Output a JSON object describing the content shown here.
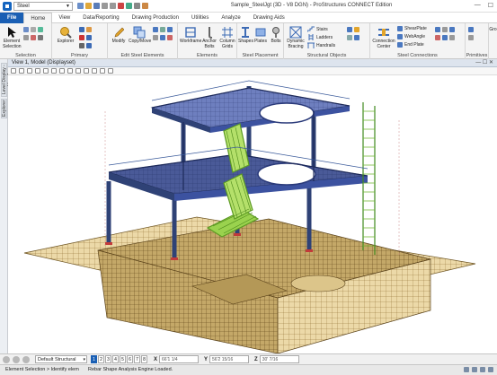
{
  "window": {
    "title": "Sample_SteelJgt (3D - V8 DGN) - ProStructures CONNECT Edition",
    "workspace": "Steel"
  },
  "ribbon_tabs": [
    "File",
    "Home",
    "View",
    "Data/Reporting",
    "Drawing Production",
    "Utilities",
    "Analyze",
    "Drawing Aids"
  ],
  "ribbon": {
    "selection": {
      "label": "Selection",
      "element_selection": "Element Selection"
    },
    "primary": {
      "label": "Primary",
      "explorer": "Explorer"
    },
    "edit_steel": {
      "label": "Edit Steel Elements",
      "modify": "Modify",
      "copy_move": "Copy/Move"
    },
    "elements": {
      "label": "Elements",
      "workframe": "Workframe",
      "anchor_bolts": "Anchor Bolts",
      "column_grids": "Column Grids"
    },
    "steel_placement": {
      "label": "Steel Placement",
      "shapes": "Shapes",
      "plates": "Plates",
      "bolts": "Bolts"
    },
    "structural_objects": {
      "label": "Structural Objects",
      "dynamic_bracing": "Dynamic Bracing",
      "stairs": "Stairs",
      "ladders": "Ladders",
      "handrails": "Handrails"
    },
    "steel_connections": {
      "label": "Steel Connections",
      "connection_center": "Connection Center",
      "shear_plate": "ShearPlate",
      "web_angle": "WebAngle",
      "end_plate": "End Plate"
    },
    "primitives": {
      "label": "Primitives"
    },
    "extra": {
      "label": "Gro"
    }
  },
  "view": {
    "title": "View 1, Model (Displayset)",
    "side_tabs": [
      "Level Display - View 1",
      "Explorer"
    ]
  },
  "bottom": {
    "model": "Default Structural mod",
    "view_numbers": [
      "1",
      "2",
      "3",
      "4",
      "5",
      "6",
      "7",
      "8"
    ],
    "x_label": "X",
    "x_value": "66'1 1/4",
    "y_label": "Y",
    "y_value": "56'2 15/16",
    "z_label": "Z",
    "z_value": "30' 7/16"
  },
  "status": {
    "prompt": "Element Selection > Identify elem",
    "message": "Rebar Shape Analysis Engine Loaded."
  },
  "colors": {
    "file_tab": "#1a5fb4",
    "steel_blue": "#3a4f8c",
    "foundation": "#9a7b3e",
    "stair_green": "#7fbf3f"
  }
}
